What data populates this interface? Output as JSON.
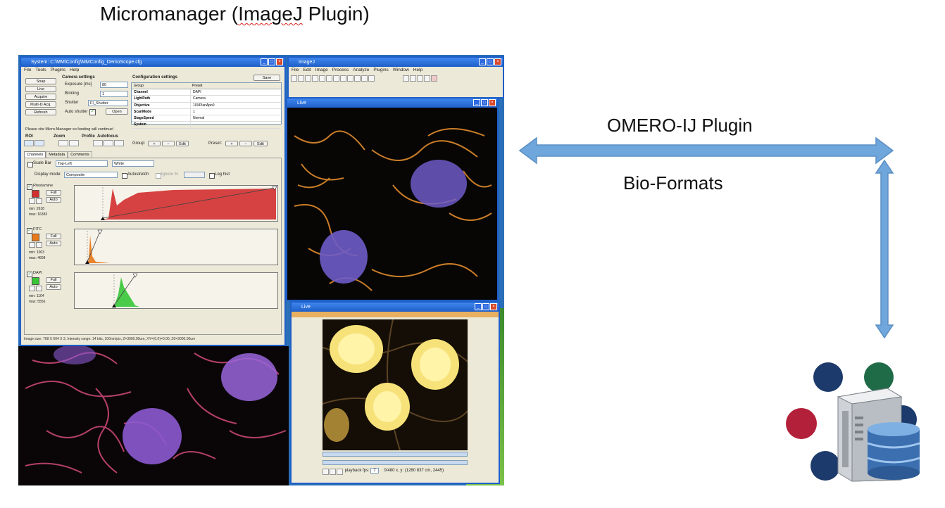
{
  "heading": {
    "prefix": "Micromanager (",
    "underlined": "ImageJ",
    "suffix": " Plugin)"
  },
  "labels": {
    "omero_ij": "OMERO-IJ Plugin",
    "bio_formats": "Bio-Formats"
  },
  "colors": {
    "arrow_fill": "#6fa6dc",
    "arrow_stroke": "#5b8fc4",
    "omero_dark_blue": "#1c3a6b",
    "omero_green": "#1f6b48",
    "omero_red": "#b3203a"
  },
  "screenshot": {
    "mm_window": {
      "title": "System: C:\\MM\\Config\\MMConfig_DemoScope.cfg",
      "menu": [
        "File",
        "Tools",
        "Plugins",
        "Help"
      ],
      "buttons": [
        "Snap",
        "Live",
        "Acquire",
        "Multi-D Acq.",
        "Refresh"
      ],
      "camera_settings": "Camera settings",
      "exposure_label": "Exposure [ms]",
      "exposure_value": "80",
      "binning_label": "Binning",
      "binning_value": "1",
      "shutter_label": "Shutter",
      "shutter_value": "FI_Shutter",
      "auto_shutter": "Auto shutter",
      "open_label": "Open",
      "config_settings": "Configuration settings",
      "save_label": "Save",
      "group_header": "Group",
      "preset_header": "Preset",
      "config_rows": [
        {
          "group": "Channel",
          "preset": "DAPI"
        },
        {
          "group": "LightPath",
          "preset": "Camera"
        },
        {
          "group": "Objective",
          "preset": "10XPlanApo0"
        },
        {
          "group": "ScanMode",
          "preset": "1"
        },
        {
          "group": "StageSpeed",
          "preset": "Normal"
        },
        {
          "group": "System",
          "preset": ""
        }
      ],
      "cite_line": "Please cite Micro-Manager so funding will continue!",
      "roi_label": "ROI",
      "zoom_label": "Zoom",
      "profile_label": "Profile",
      "autofocus_label": "Autofocus",
      "group_label": "Group:",
      "preset_label": "Preset:",
      "edit_label": "Edit",
      "tabs": [
        "Channels",
        "Metadata",
        "Comments"
      ],
      "scale_bar": "Scale Bar",
      "scale_pos": "Top-Left",
      "scale_color": "White",
      "display_mode_label": "Display mode:",
      "display_mode": "Composite",
      "autostretch": "Autostretch",
      "ignore": "Ignore %",
      "log_hist": "Log hist",
      "full_label": "Full",
      "auto_label": "Auto",
      "channels": [
        {
          "name": "Rhodamine",
          "color": "#d32f2f",
          "min": "min: 2618",
          "max": "max: 16383"
        },
        {
          "name": "FITC",
          "color": "#e8781a",
          "min": "min: 1003",
          "max": "max: 4608"
        },
        {
          "name": "DAPI",
          "color": "#37c637",
          "min": "min: 1104",
          "max": "max: 5556"
        }
      ],
      "status_line": "Image size: 768 X 604 X 3, Intensity range: 14 bits, 100nm/pix, Z=3000.00um, XY=(0,0)=0.00, Z0=3000.00um"
    },
    "ij_window": {
      "title": "ImageJ",
      "menu": [
        "File",
        "Edit",
        "Image",
        "Process",
        "Analyze",
        "Plugins",
        "Window",
        "Help"
      ]
    },
    "image_window_title": "Live",
    "stack_window": {
      "title": "Live",
      "playback_label": "playback fps:",
      "playback_value": "7",
      "info": "0/480 x, y: (1280 837 cm, 2445)"
    }
  }
}
